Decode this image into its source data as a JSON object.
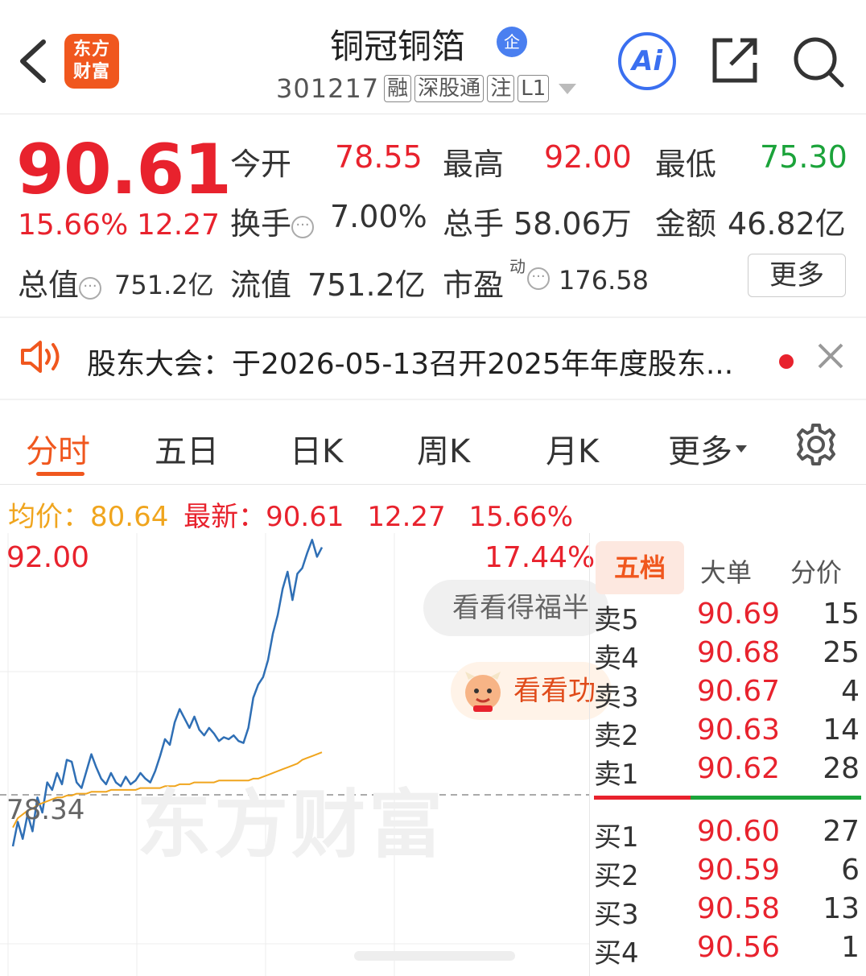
{
  "header": {
    "logo_text": "东方财富",
    "stock_name": "铜冠铜箔",
    "enterprise_badge": "企",
    "stock_code": "301217",
    "tags": [
      "融",
      "深股通",
      "注",
      "L1"
    ],
    "ai_label": "Ai"
  },
  "quote": {
    "price": "90.61",
    "change_pct": "15.66%",
    "change_amt": "12.27",
    "open_label": "今开",
    "open": "78.55",
    "high_label": "最高",
    "high": "92.00",
    "low_label": "最低",
    "low": "75.30",
    "turnover_label": "换手",
    "turnover": "7.00%",
    "volume_label": "总手",
    "volume": "58.06万",
    "amount_label": "金额",
    "amount": "46.82亿",
    "mcap_label": "总值",
    "mcap": "751.2亿",
    "float_label": "流值",
    "float_cap": "751.2亿",
    "pe_label": "市盈",
    "pe_sup": "动",
    "pe": "176.58",
    "more_label": "更多"
  },
  "notice": {
    "text": "股东大会：于2026-05-13召开2025年年度股东..."
  },
  "tabs": {
    "items": [
      "分时",
      "五日",
      "日K",
      "周K",
      "月K",
      "更多"
    ]
  },
  "avg_line": {
    "avg_label": "均价：",
    "avg": "80.64",
    "latest_label": "最新：",
    "latest": "90.61",
    "change_amt": "12.27",
    "change_pct": "15.66%"
  },
  "chart": {
    "y_top": "92.00",
    "y_top_pct": "17.44%",
    "y_ref": "78.34",
    "watermark": "东方财富",
    "pill1_text": "看看得福半",
    "pill2_text": "看看功"
  },
  "chart_data": {
    "type": "line",
    "ylim": [
      75.3,
      92.0
    ],
    "reference_price": 78.34,
    "series": [
      {
        "values": [
          75.6,
          76.9,
          76.0,
          77.3,
          76.4,
          78.2,
          77.4,
          79.0,
          78.6,
          79.5,
          78.9,
          80.2,
          80.1,
          79.0,
          78.7,
          79.6,
          80.5,
          79.8,
          79.2,
          78.9,
          79.5,
          79.0,
          78.8,
          79.3,
          78.9,
          79.1,
          79.5,
          79.2,
          79.0,
          79.6,
          80.4,
          81.3,
          81.0,
          82.2,
          82.9,
          82.4,
          81.9,
          82.5,
          81.8,
          81.5,
          81.9,
          81.6,
          81.2,
          81.4,
          81.3,
          81.5,
          81.2,
          81.1,
          81.9,
          83.5,
          84.2,
          84.6,
          85.5,
          86.9,
          87.9,
          89.3,
          90.2,
          88.7,
          90.1,
          90.4,
          91.2,
          91.9,
          91.0,
          91.5
        ]
      },
      {
        "values": [
          76.6,
          77.1,
          77.3,
          77.5,
          77.6,
          77.8,
          77.9,
          78.0,
          78.1,
          78.2,
          78.2,
          78.3,
          78.3,
          78.4,
          78.4,
          78.4,
          78.5,
          78.5,
          78.5,
          78.5,
          78.6,
          78.6,
          78.6,
          78.6,
          78.6,
          78.6,
          78.7,
          78.7,
          78.7,
          78.7,
          78.7,
          78.8,
          78.8,
          78.8,
          78.9,
          78.9,
          78.9,
          79.0,
          79.0,
          79.0,
          79.0,
          79.0,
          79.1,
          79.1,
          79.1,
          79.1,
          79.1,
          79.1,
          79.1,
          79.2,
          79.2,
          79.3,
          79.4,
          79.5,
          79.6,
          79.7,
          79.8,
          79.9,
          80.0,
          80.2,
          80.3,
          80.4,
          80.5,
          80.6
        ]
      }
    ],
    "colors": [
      "#2f6fb5",
      "#f0a51e"
    ]
  },
  "order_book": {
    "tabs": [
      "五档",
      "大单",
      "分价"
    ],
    "sells": [
      {
        "label": "卖5",
        "price": "90.69",
        "vol": "15"
      },
      {
        "label": "卖4",
        "price": "90.68",
        "vol": "25"
      },
      {
        "label": "卖3",
        "price": "90.67",
        "vol": "4"
      },
      {
        "label": "卖2",
        "price": "90.63",
        "vol": "14"
      },
      {
        "label": "卖1",
        "price": "90.62",
        "vol": "28"
      }
    ],
    "buys": [
      {
        "label": "买1",
        "price": "90.60",
        "vol": "27"
      },
      {
        "label": "买2",
        "price": "90.59",
        "vol": "6"
      },
      {
        "label": "买3",
        "price": "90.58",
        "vol": "13"
      },
      {
        "label": "买4",
        "price": "90.56",
        "vol": "1"
      }
    ]
  }
}
